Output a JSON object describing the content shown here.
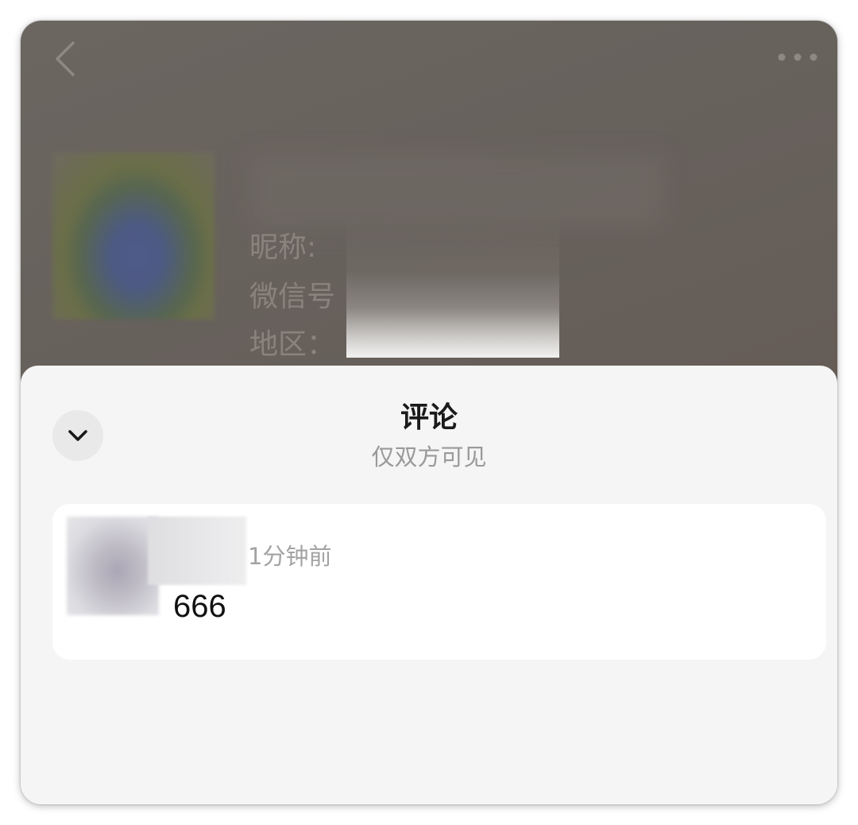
{
  "profile": {
    "nickname_label": "昵称:",
    "wechat_id_label": "微信号",
    "region_label": "地区："
  },
  "icons": {
    "back": "chevron-left-icon",
    "more": "more-dots-icon",
    "collapse": "chevron-down-icon"
  },
  "comments_sheet": {
    "title": "评论",
    "subtitle": "仅双方可见",
    "comments": [
      {
        "time": "1分钟前",
        "text": "666"
      }
    ]
  },
  "colors": {
    "sheet_background": "#f5f5f5",
    "card_background": "#ffffff",
    "dim_overlay": "#67615c",
    "secondary_text": "#9a9a9a"
  }
}
